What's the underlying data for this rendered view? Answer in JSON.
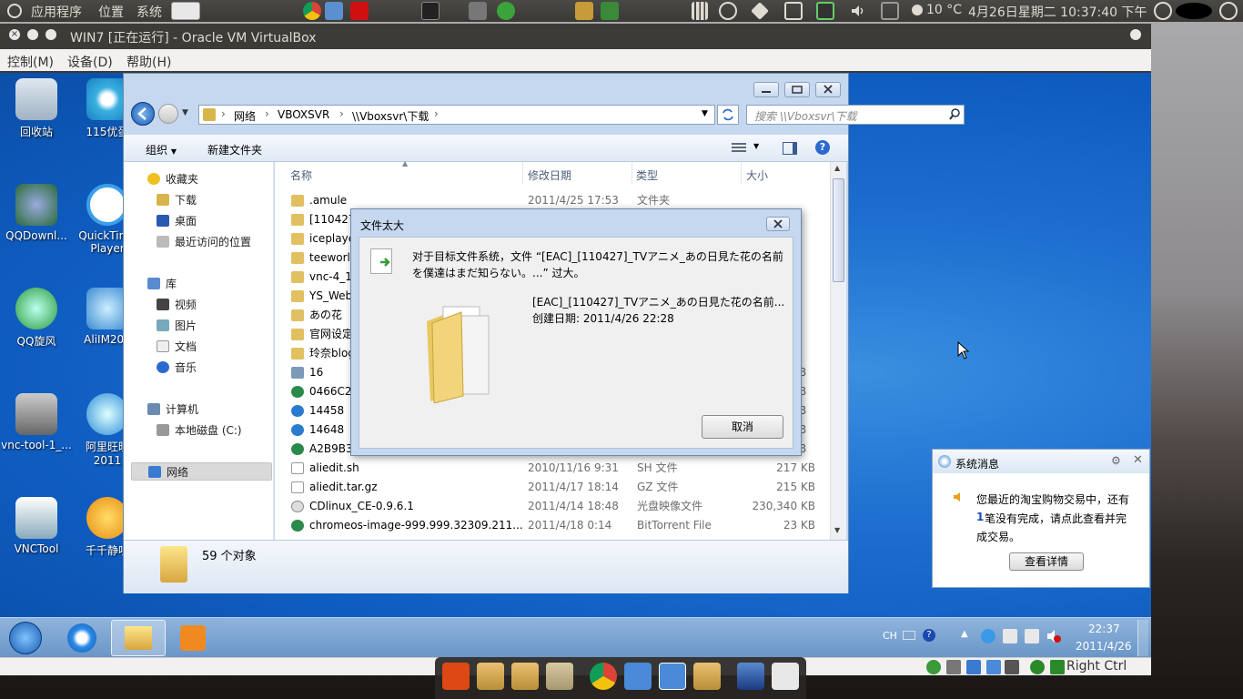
{
  "top_panel": {
    "menu_apps": "应用程序",
    "menu_places": "位置",
    "menu_system": "系统",
    "weather": "10 °C",
    "clock": "4月26日星期二 10:37:40 下午"
  },
  "vbox": {
    "title": "WIN7 [正在运行] - Oracle VM VirtualBox",
    "menu_control": "控制(M)",
    "menu_devices": "设备(D)",
    "menu_help": "帮助(H)",
    "host_key": "Right Ctrl"
  },
  "desktop_icons": [
    {
      "label": "回收站"
    },
    {
      "label": "115优蛋"
    },
    {
      "label": "QQDownl..."
    },
    {
      "label": "QuickTime Player"
    },
    {
      "label": "QQ旋风"
    },
    {
      "label": "AliIM201"
    },
    {
      "label": "vnc-tool-1_..."
    },
    {
      "label": "阿里旺旺 2011"
    },
    {
      "label": "VNCTool"
    },
    {
      "label": "千千静听"
    }
  ],
  "explorer": {
    "breadcrumb": [
      "网络",
      "VBOXSVR",
      "\\\\Vboxsvr\\下载"
    ],
    "search_placeholder": "搜索 \\\\Vboxsvr\\下载",
    "organize": "组织",
    "new_folder": "新建文件夹",
    "nav": {
      "favorites": "收藏夹",
      "downloads": "下载",
      "desktop": "桌面",
      "recent": "最近访问的位置",
      "library": "库",
      "videos": "视频",
      "pictures": "图片",
      "documents": "文档",
      "music": "音乐",
      "computer": "计算机",
      "local_disk": "本地磁盘 (C:)",
      "network": "网络"
    },
    "columns": {
      "name": "名称",
      "date": "修改日期",
      "type": "类型",
      "size": "大小"
    },
    "rows": [
      {
        "name": ".amule",
        "date": "2011/4/25 17:53",
        "type": "文件夹",
        "size": ""
      },
      {
        "name": "[110427",
        "date": "",
        "type": "",
        "size": ""
      },
      {
        "name": "iceplaye",
        "date": "",
        "type": "",
        "size": ""
      },
      {
        "name": "teeworl",
        "date": "",
        "type": "",
        "size": ""
      },
      {
        "name": "vnc-4_1",
        "date": "",
        "type": "",
        "size": ""
      },
      {
        "name": "YS_Web",
        "date": "",
        "type": "",
        "size": ""
      },
      {
        "name": "あの花",
        "date": "",
        "type": "",
        "size": ""
      },
      {
        "name": "官网设定",
        "date": "",
        "type": "",
        "size": ""
      },
      {
        "name": "玲奈blog",
        "date": "",
        "type": "",
        "size": ""
      },
      {
        "name": "16",
        "date": "",
        "type": "",
        "size": "B"
      },
      {
        "name": "0466C2",
        "date": "",
        "type": "",
        "size": "B"
      },
      {
        "name": "14458",
        "date": "",
        "type": "",
        "size": "B"
      },
      {
        "name": "14648",
        "date": "",
        "type": "",
        "size": "B"
      },
      {
        "name": "A2B9B3",
        "date": "",
        "type": "",
        "size": "B"
      },
      {
        "name": "aliedit.sh",
        "date": "2010/11/16 9:31",
        "type": "SH 文件",
        "size": "217 KB"
      },
      {
        "name": "aliedit.tar.gz",
        "date": "2011/4/17 18:14",
        "type": "GZ 文件",
        "size": "215 KB"
      },
      {
        "name": "CDlinux_CE-0.9.6.1",
        "date": "2011/4/14 18:48",
        "type": "光盘映像文件",
        "size": "230,340 KB"
      },
      {
        "name": "chromeos-image-999.999.32309.211...",
        "date": "2011/4/18 0:14",
        "type": "BitTorrent File",
        "size": "23 KB"
      }
    ],
    "status_count": "59 个对象"
  },
  "dialog": {
    "title": "文件太大",
    "message_line1": "对于目标文件系统，文件 “[EAC]_[110427]_TVアニメ_あの日見た花の名前",
    "message_line2": "を僕達はまだ知らない。...” 过大。",
    "file_name": "[EAC]_[110427]_TVアニメ_あの日見た花の名前...",
    "created": "创建日期: 2011/4/26 22:28",
    "cancel": "取消"
  },
  "notification": {
    "title": "系统消息",
    "line1": "您最近的淘宝购物交易中，还有",
    "count": "1",
    "line2": "笔没有完成，请点此查看并完",
    "line3": "成交易。",
    "button": "查看详情"
  },
  "win_taskbar": {
    "lang": "CH",
    "time": "22:37",
    "date": "2011/4/26"
  },
  "colors": {
    "ubuntu_panel": "#3c3b37",
    "win7_blue": "#1e6fd0",
    "accent_orange": "#dd4814"
  }
}
